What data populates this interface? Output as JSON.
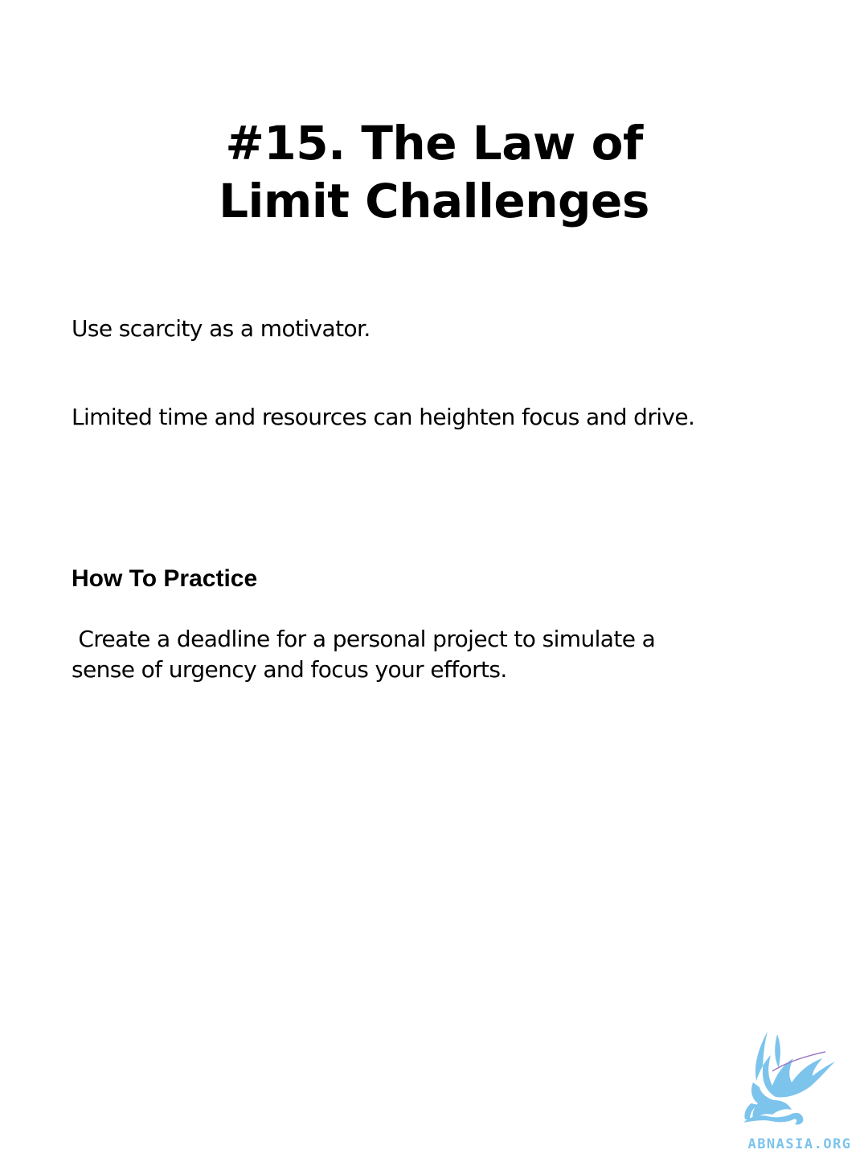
{
  "title": {
    "line1": "#15. The Law of",
    "line2": "Limit Challenges"
  },
  "body": {
    "line1": "Use scarcity as a motivator.",
    "line2": "Limited time and resources can heighten focus and drive."
  },
  "practice": {
    "heading": "How To Practice",
    "text": " Create a deadline for a personal project to simulate a\nsense of urgency and focus your efforts."
  },
  "logo": {
    "icon": "griffin-logo-icon",
    "text": "ABNASIA.ORG",
    "color": "#7cc4ec"
  }
}
